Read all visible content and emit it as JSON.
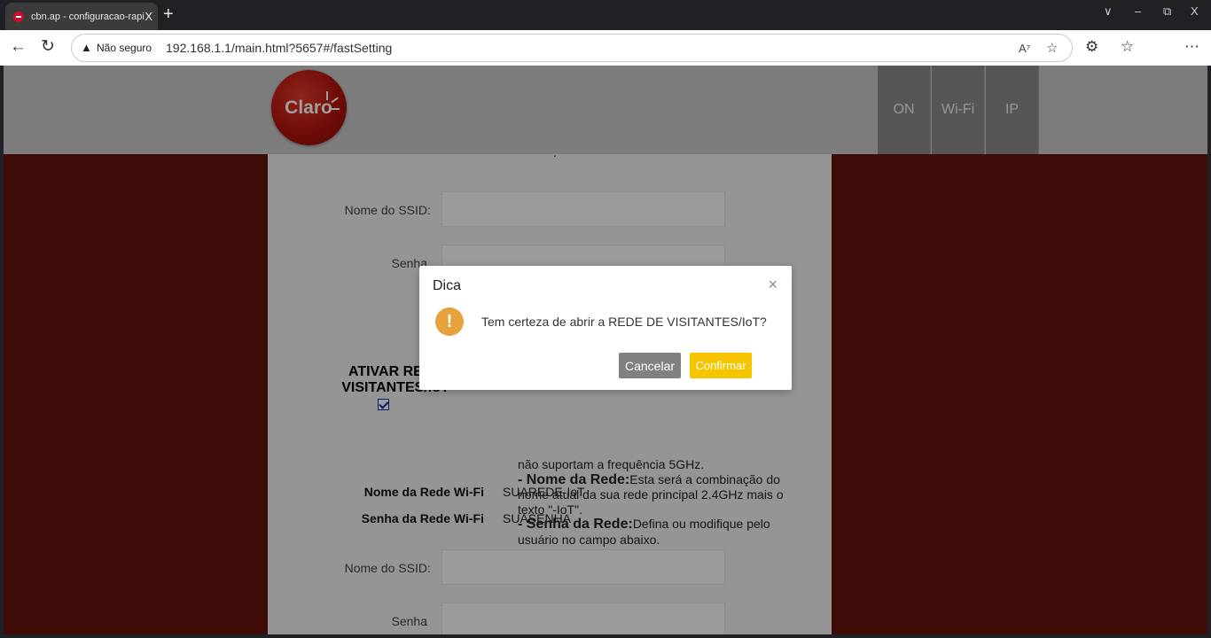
{
  "browser": {
    "tab_title": "cbn.ap - configuracao-rapida - Li",
    "tab_close": "X",
    "new_tab": "+",
    "window_controls": {
      "collapse": "∨",
      "minimize": "–",
      "restore": "⧉",
      "close": "X"
    },
    "security_label": "Não seguro",
    "url": "192.168.1.1/main.html?5657#/fastSetting"
  },
  "header": {
    "logo_text": "Claro",
    "nav_tabs": [
      "ON",
      "Wi-Fi",
      "IP"
    ]
  },
  "form": {
    "ssid_label_1": "Nome do SSID",
    "password_label_1": "Senha",
    "guest_toggle_label": "ATIVAR REDE VISITANTES/IoT",
    "guest_checked": true,
    "description": {
      "partial_line": "não suportam a frequência 5GHz.",
      "network_name_heading": "- Nome da Rede:",
      "network_name_text": "Esta será a combinação do nome atual da sua rede principal 2.4GHz mais o texto \"-IoT\".",
      "network_password_heading": "- Senha da Rede:",
      "network_password_text": "Defina ou modifique pelo usuário no campo abaixo."
    },
    "wifi_name_label": "Nome da Rede Wi-Fi",
    "wifi_name_value": "SUAREDE-IoT",
    "wifi_password_label": "Senha da Rede Wi-Fi",
    "wifi_password_value": "SUASENHA",
    "ssid_label_2": "Nome do SSID",
    "password_label_2": "Senha",
    "colon": ":",
    "dot": "."
  },
  "dialog": {
    "title": "Dica",
    "close": "×",
    "icon": "!",
    "message": "Tem certeza de abrir a REDE DE VISITANTES/IoT?",
    "cancel_label": "Cancelar",
    "confirm_label": "Confirmar"
  },
  "colors": {
    "brand_red": "#671310",
    "confirm_yellow": "#f7c400",
    "warning_orange": "#e6a23c"
  }
}
